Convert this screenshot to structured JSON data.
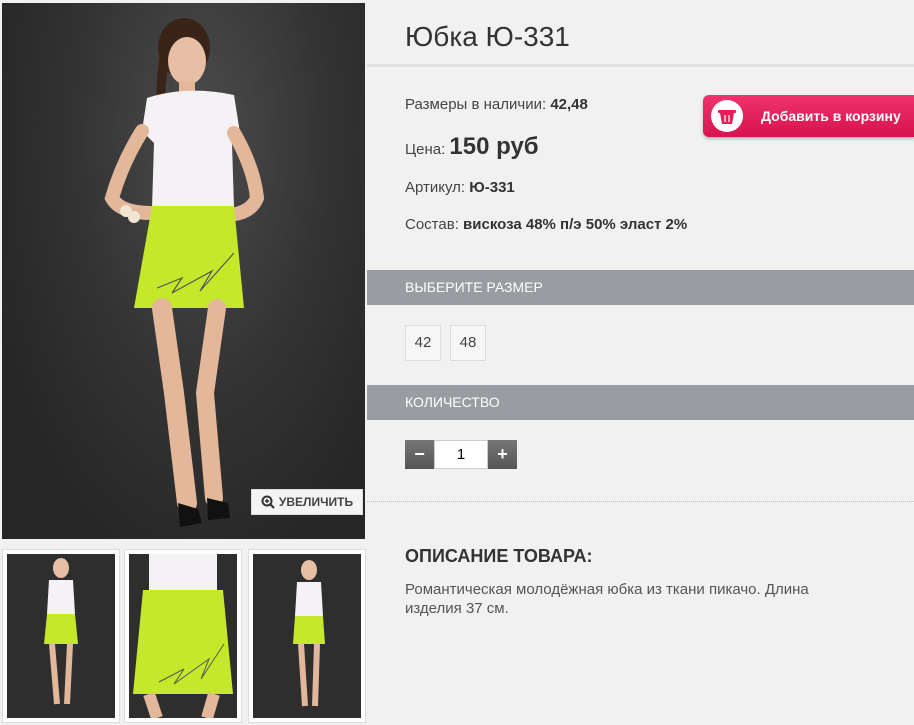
{
  "product": {
    "title": "Юбка Ю-331",
    "sizes_label": "Размеры в наличии:",
    "sizes_value": "42,48",
    "price_label": "Цена:",
    "price_value": "150 руб",
    "article_label": "Артикул:",
    "article_value": "Ю-331",
    "composition_label": "Состав:",
    "composition_value": "вискоза 48% п/э 50% эласт 2%"
  },
  "cart": {
    "label": "Добавить в корзину",
    "icon": "basket-icon"
  },
  "gallery": {
    "zoom_label": "УВЕЛИЧИТЬ",
    "zoom_icon": "magnifier-plus-icon"
  },
  "size_section": {
    "title": "ВЫБЕРИТЕ РАЗМЕР",
    "options": [
      "42",
      "48"
    ]
  },
  "quantity_section": {
    "title": "КОЛИЧЕСТВО",
    "minus": "−",
    "plus": "+",
    "value": "1"
  },
  "description": {
    "title": "ОПИСАНИЕ ТОВАРА:",
    "text": "Романтическая молодёжная юбка из ткани пикачо. Длина изделия 37 см."
  },
  "colors": {
    "accent": "#e61d56",
    "section_bar": "#999ca1",
    "skirt": "#c6e82a"
  }
}
